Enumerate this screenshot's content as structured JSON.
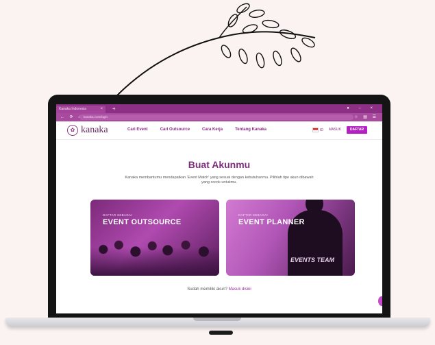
{
  "browser": {
    "tab_title": "Kanaka Indonesia",
    "tab_close": "×",
    "new_tab": "+",
    "window_controls": "● – ×",
    "nav_buttons": "← ⟳ ⌂",
    "url": "kanaka.com/login",
    "url_icons": "☆ ▤ ☰"
  },
  "site": {
    "logo_mark": "✿",
    "logo_text": "kanaka",
    "menu": [
      "Cari Event",
      "Cari Outsource",
      "Cara Kerja",
      "Tentang Kanaka"
    ],
    "lang": "ID",
    "masuk": "MASUK",
    "daftar": "DAFTAR"
  },
  "page": {
    "title": "Buat Akunmu",
    "subtitle": "Kanaka membantumu mendapatkan 'Event Match' yang sesuai dengan kebutuhanmu. Pilihlah tipe akun dibawah yang cocok untukmu.",
    "cards": [
      {
        "tag": "DAFTAR SEBAGAI",
        "title": "EVENT OUTSOURCE"
      },
      {
        "tag": "DAFTAR SEBAGAI",
        "title": "EVENT PLANNER",
        "shirt_text": "EVENTS TEAM"
      }
    ],
    "login_prompt": "Sudah memiliki akun?",
    "login_link": "Masuk disini"
  },
  "colors": {
    "brand_purple": "#8a2c86",
    "accent_magenta": "#b51fc4",
    "tab_bar": "#8d2f84"
  }
}
